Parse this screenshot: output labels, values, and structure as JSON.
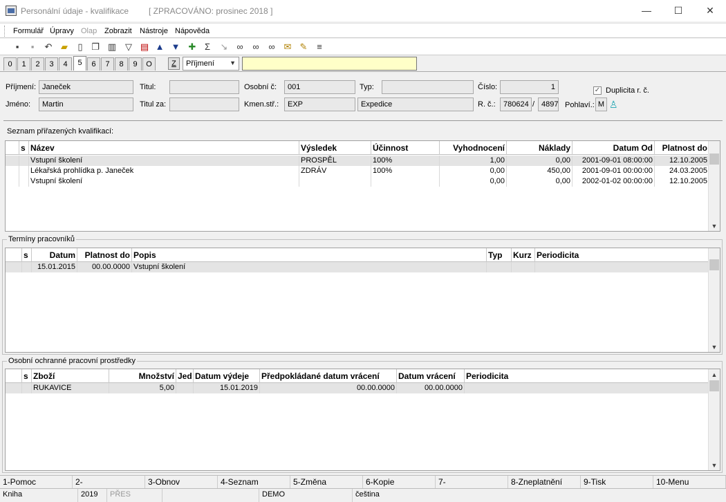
{
  "window": {
    "title": "Personální údaje - kvalifikace",
    "status": "[ ZPRACOVÁNO: prosinec 2018 ]",
    "minimize": "—",
    "maximize": "☐",
    "close": "✕"
  },
  "menu": [
    "Formulář",
    "Úpravy",
    "Olap",
    "Zobrazit",
    "Nástroje",
    "Nápověda"
  ],
  "toolbar_icons": [
    "save-icon",
    "save-close-icon",
    "undo-icon",
    "open-icon",
    "new-icon",
    "copy-icon",
    "book-icon",
    "filter-icon",
    "filter-clear-icon",
    "up-arrow-icon",
    "down-arrow-icon",
    "refresh-icon",
    "sum-icon",
    "export-icon",
    "binoculars-icon",
    "binoculars-next-icon",
    "binoculars-prev-icon",
    "mail-icon",
    "note-icon",
    "menu-icon"
  ],
  "tabs": [
    "0",
    "1",
    "2",
    "3",
    "4",
    "5",
    "6",
    "7",
    "8",
    "9",
    "O"
  ],
  "active_tab": "5",
  "sort": {
    "z_label": "Z",
    "selected": "Příjmení",
    "search_value": ""
  },
  "form": {
    "prijmeni_label": "Příjmení:",
    "prijmeni": "Janeček",
    "jmeno_label": "Jméno:",
    "jmeno": "Martin",
    "titul_label": "Titul:",
    "titul": "",
    "titul_za_label": "Titul za:",
    "titul_za": "",
    "osobni_c_label": "Osobní č:",
    "osobni_c": "001",
    "kmen_str_label": "Kmen.stř.:",
    "kmen_str": "EXP",
    "kmen_str_name": "Expedice",
    "typ_label": "Typ:",
    "typ": "",
    "cislo_label": "Číslo:",
    "cislo": "1",
    "rc_label": "R. č.:",
    "rc1": "780624",
    "rc_sep": "/",
    "rc2": "4897",
    "pohlavi_label": "Pohlaví.:",
    "pohlavi": "M",
    "duplicita_label": "Duplicita r. č.",
    "duplicita_checked": "✓"
  },
  "kvalifikace": {
    "title": "Seznam přiřazených kvalifikací:",
    "columns": [
      "s",
      "Název",
      "Výsledek",
      "Účinnost",
      "Vyhodnocení",
      "Náklady",
      "Datum Od",
      "Platnost do"
    ],
    "rows": [
      [
        "",
        "Vstupní školení",
        "PROSPĚL",
        "100%",
        "1,00",
        "0,00",
        "2001-09-01 08:00:00",
        "12.10.2005"
      ],
      [
        "",
        "Lékařská prohlídka p. Janeček",
        "ZDRÁV",
        "100%",
        "0,00",
        "450,00",
        "2001-09-01 00:00:00",
        "24.03.2005"
      ],
      [
        "",
        "Vstupní školení",
        "",
        "",
        "0,00",
        "0,00",
        "2002-01-02 00:00:00",
        "12.10.2005"
      ]
    ]
  },
  "terminy": {
    "title": "Termíny pracovníků",
    "columns": [
      "s",
      "Datum",
      "Platnost do",
      "Popis",
      "Typ",
      "Kurz",
      "Periodicita"
    ],
    "rows": [
      [
        "",
        "15.01.2015",
        "00.00.0000",
        "Vstupní školení",
        "",
        "",
        ""
      ]
    ]
  },
  "oopp": {
    "title": "Osobní ochranné pracovní prostředky",
    "columns": [
      "s",
      "Zboží",
      "Množství",
      "Jed",
      "Datum výdeje",
      "Předpokládané datum vrácení",
      "Datum vrácení",
      "Periodicita"
    ],
    "rows": [
      [
        "",
        "RUKAVICE",
        "5,00",
        "",
        "15.01.2019",
        "00.00.0000",
        "00.00.0000",
        ""
      ]
    ]
  },
  "fkeys": [
    "1-Pomoc",
    "2-",
    "3-Obnov",
    "4-Seznam",
    "5-Změna",
    "6-Kopie",
    "7-",
    "8-Zneplatnění",
    "9-Tisk",
    "10-Menu"
  ],
  "status": [
    "Kniha",
    "2019",
    "PŘES",
    "",
    "DEMO",
    "čeština"
  ]
}
